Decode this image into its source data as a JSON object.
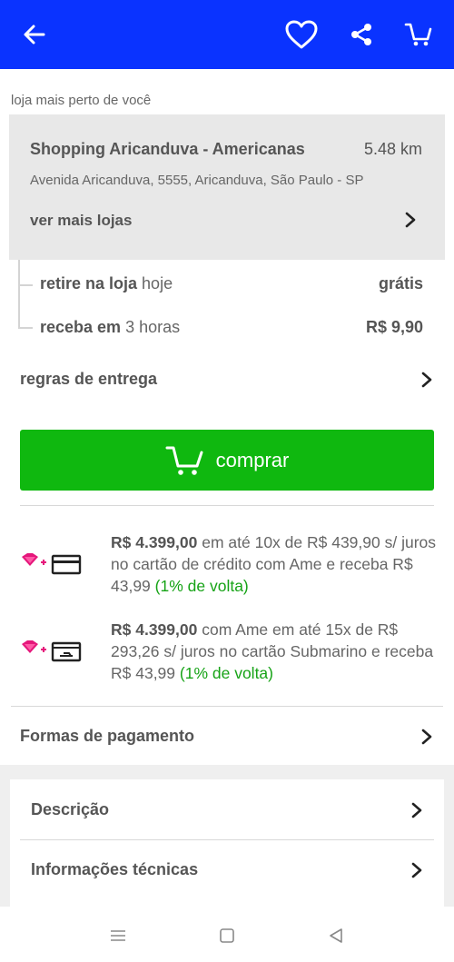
{
  "colors": {
    "topbar": "#0a33ff",
    "buy_button": "#0fb80f",
    "cashback": "#16a316",
    "ame_icon": "#e5177b"
  },
  "topbar": {
    "icons": [
      "back-arrow-icon",
      "heart-icon",
      "share-icon",
      "cart-icon"
    ]
  },
  "store": {
    "section_label": "loja mais perto de você",
    "name": "Shopping Aricanduva - Americanas",
    "distance": "5.48 km",
    "address": "Avenida Aricanduva, 5555, Aricanduva, São Paulo - SP",
    "more_stores": "ver mais lojas"
  },
  "delivery_options": [
    {
      "label_bold": "retire na loja",
      "label_rest": " hoje",
      "price": "grátis"
    },
    {
      "label_bold": "receba em",
      "label_rest": " 3 horas",
      "price": "R$ 9,90"
    }
  ],
  "delivery_rules": "regras de entrega",
  "buy_button": {
    "label": "comprar"
  },
  "payment_offers": [
    {
      "price": "R$ 4.399,00",
      "text": " em até 10x de R$ 439,90 s/ juros no cartão de crédito com Ame e receba R$ 43,99 ",
      "cashback": "(1% de volta)"
    },
    {
      "price": "R$ 4.399,00",
      "text": " com Ame em até 15x de R$ 293,26 s/ juros no cartão Submarino e receba R$ 43,99 ",
      "cashback": "(1% de volta)"
    }
  ],
  "payment_methods": "Formas de pagamento",
  "accordion": [
    {
      "label": "Descrição"
    },
    {
      "label": "Informações técnicas"
    }
  ]
}
